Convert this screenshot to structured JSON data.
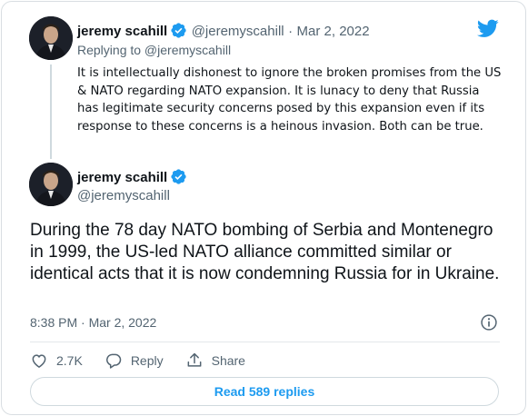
{
  "quoted_tweet": {
    "author_name": "jeremy scahill",
    "handle": "@jeremyscahill",
    "separator": "·",
    "date": "Mar 2, 2022",
    "replying_to": "Replying to @jeremyscahill",
    "text": "It is intellectually dishonest to ignore the broken promises from the US & NATO regarding NATO expansion. It is lunacy to deny that Russia has legitimate security concerns posed by this expansion even if its response to these concerns is a heinous invasion. Both can be true."
  },
  "main_tweet": {
    "author_name": "jeremy scahill",
    "handle": "@jeremyscahill",
    "text": "During the 78 day NATO bombing of Serbia and Montenegro in 1999, the US-led NATO alliance committed similar or identical acts that it is now condemning Russia for in Ukraine.",
    "timestamp": "8:38 PM · Mar 2, 2022"
  },
  "actions": {
    "like_count": "2.7K",
    "reply_label": "Reply",
    "share_label": "Share"
  },
  "read_replies_label": "Read 589 replies",
  "icons": {
    "logo": "twitter-bird-icon",
    "verified": "verified-badge-icon",
    "info": "info-icon",
    "like": "heart-icon",
    "reply": "speech-bubble-icon",
    "share": "share-upload-icon"
  },
  "colors": {
    "accent": "#1d9bf0",
    "text": "#0f1419",
    "muted": "#536471",
    "border": "#cfd9de"
  }
}
